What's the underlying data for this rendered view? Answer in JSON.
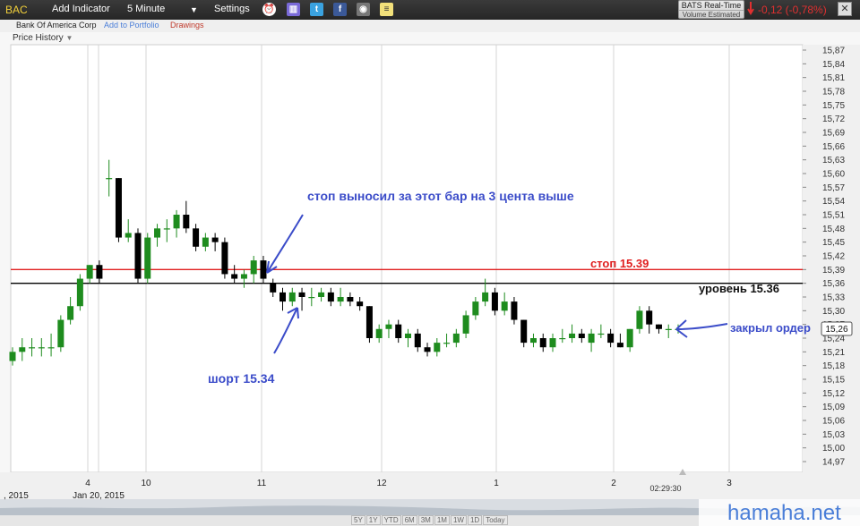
{
  "toolbar": {
    "ticker": "BAC",
    "add_indicator": "Add Indicator",
    "interval": "5 Minute",
    "settings": "Settings",
    "bats_title": "BATS Real-Time",
    "bats_sub": "Volume Estimated",
    "change": "-0,12 (-0,78%)"
  },
  "subbar": {
    "company": "Bank Of America Corp",
    "add_portfolio": "Add to Portfolio",
    "drawings": "Drawings"
  },
  "chart_title": "Price History",
  "range_buttons": [
    "5Y",
    "1Y",
    "YTD",
    "6M",
    "3M",
    "1M",
    "1W",
    "1D",
    "Today"
  ],
  "watermark": "hamaha.net",
  "colors": {
    "up": "#1e8c1e",
    "down": "#000000",
    "stop_line": "#e02020",
    "level_line": "#000000",
    "annotation": "#3b4cc9"
  },
  "chart_data": {
    "type": "candlestick",
    "yaxis_ticks": [
      "15,87",
      "15,84",
      "15,81",
      "15,78",
      "15,75",
      "15,72",
      "15,69",
      "15,66",
      "15,63",
      "15,60",
      "15,57",
      "15,54",
      "15,51",
      "15,48",
      "15,45",
      "15,42",
      "15,39",
      "15,36",
      "15,33",
      "15,30",
      "15,27",
      "15,24",
      "15,21",
      "15,18",
      "15,15",
      "15,12",
      "15,09",
      "15,06",
      "15,03",
      "15,00",
      "14,97"
    ],
    "ylim": [
      14.95,
      15.89
    ],
    "xaxis_labels": [
      ", 2015",
      "Jan 20, 2015",
      "4",
      "10",
      "11",
      "12",
      "1",
      "2",
      "3"
    ],
    "time_label": "02:29:30",
    "last_price": "15,26",
    "levels": [
      {
        "name": "stop",
        "value": 15.39,
        "label": "стоп 15.39"
      },
      {
        "name": "level",
        "value": 15.36,
        "label": "уровень 15.36"
      }
    ],
    "annotations": [
      {
        "name": "stop-note",
        "text": "стоп выносил за этот бар на 3 цента выше"
      },
      {
        "name": "short-note",
        "text": "шорт 15.34"
      },
      {
        "name": "close-note",
        "text": "закрыл ордер"
      }
    ],
    "candles": [
      {
        "o": 15.19,
        "h": 15.22,
        "l": 15.18,
        "c": 15.21
      },
      {
        "o": 15.21,
        "h": 15.24,
        "l": 15.19,
        "c": 15.22
      },
      {
        "o": 15.22,
        "h": 15.24,
        "l": 15.2,
        "c": 15.22
      },
      {
        "o": 15.22,
        "h": 15.24,
        "l": 15.2,
        "c": 15.22
      },
      {
        "o": 15.22,
        "h": 15.25,
        "l": 15.2,
        "c": 15.22
      },
      {
        "o": 15.22,
        "h": 15.29,
        "l": 15.21,
        "c": 15.28
      },
      {
        "o": 15.28,
        "h": 15.33,
        "l": 15.27,
        "c": 15.31
      },
      {
        "o": 15.31,
        "h": 15.38,
        "l": 15.3,
        "c": 15.37
      },
      {
        "o": 15.37,
        "h": 15.4,
        "l": 15.36,
        "c": 15.4
      },
      {
        "o": 15.4,
        "h": 15.41,
        "l": 15.36,
        "c": 15.37
      },
      {
        "o": 15.59,
        "h": 15.63,
        "l": 15.55,
        "c": 15.59
      },
      {
        "o": 15.59,
        "h": 15.59,
        "l": 15.45,
        "c": 15.46
      },
      {
        "o": 15.46,
        "h": 15.5,
        "l": 15.45,
        "c": 15.47
      },
      {
        "o": 15.47,
        "h": 15.48,
        "l": 15.36,
        "c": 15.37
      },
      {
        "o": 15.37,
        "h": 15.47,
        "l": 15.36,
        "c": 15.46
      },
      {
        "o": 15.46,
        "h": 15.49,
        "l": 15.44,
        "c": 15.48
      },
      {
        "o": 15.48,
        "h": 15.5,
        "l": 15.45,
        "c": 15.48
      },
      {
        "o": 15.48,
        "h": 15.52,
        "l": 15.46,
        "c": 15.51
      },
      {
        "o": 15.51,
        "h": 15.54,
        "l": 15.47,
        "c": 15.48
      },
      {
        "o": 15.48,
        "h": 15.49,
        "l": 15.43,
        "c": 15.44
      },
      {
        "o": 15.44,
        "h": 15.47,
        "l": 15.43,
        "c": 15.46
      },
      {
        "o": 15.46,
        "h": 15.47,
        "l": 15.43,
        "c": 15.45
      },
      {
        "o": 15.45,
        "h": 15.46,
        "l": 15.37,
        "c": 15.38
      },
      {
        "o": 15.38,
        "h": 15.4,
        "l": 15.36,
        "c": 15.37
      },
      {
        "o": 15.37,
        "h": 15.39,
        "l": 15.35,
        "c": 15.38
      },
      {
        "o": 15.38,
        "h": 15.42,
        "l": 15.36,
        "c": 15.41
      },
      {
        "o": 15.41,
        "h": 15.42,
        "l": 15.36,
        "c": 15.37
      },
      {
        "o": 15.36,
        "h": 15.37,
        "l": 15.33,
        "c": 15.34
      },
      {
        "o": 15.34,
        "h": 15.35,
        "l": 15.3,
        "c": 15.32
      },
      {
        "o": 15.32,
        "h": 15.35,
        "l": 15.31,
        "c": 15.34
      },
      {
        "o": 15.34,
        "h": 15.35,
        "l": 15.3,
        "c": 15.33
      },
      {
        "o": 15.33,
        "h": 15.35,
        "l": 15.31,
        "c": 15.33
      },
      {
        "o": 15.33,
        "h": 15.35,
        "l": 15.32,
        "c": 15.34
      },
      {
        "o": 15.34,
        "h": 15.35,
        "l": 15.31,
        "c": 15.32
      },
      {
        "o": 15.32,
        "h": 15.35,
        "l": 15.31,
        "c": 15.33
      },
      {
        "o": 15.33,
        "h": 15.34,
        "l": 15.31,
        "c": 15.32
      },
      {
        "o": 15.32,
        "h": 15.33,
        "l": 15.3,
        "c": 15.31
      },
      {
        "o": 15.31,
        "h": 15.31,
        "l": 15.23,
        "c": 15.24
      },
      {
        "o": 15.24,
        "h": 15.27,
        "l": 15.23,
        "c": 15.26
      },
      {
        "o": 15.26,
        "h": 15.28,
        "l": 15.24,
        "c": 15.27
      },
      {
        "o": 15.27,
        "h": 15.28,
        "l": 15.23,
        "c": 15.24
      },
      {
        "o": 15.24,
        "h": 15.26,
        "l": 15.22,
        "c": 15.25
      },
      {
        "o": 15.25,
        "h": 15.26,
        "l": 15.21,
        "c": 15.22
      },
      {
        "o": 15.22,
        "h": 15.23,
        "l": 15.2,
        "c": 15.21
      },
      {
        "o": 15.21,
        "h": 15.24,
        "l": 15.2,
        "c": 15.23
      },
      {
        "o": 15.23,
        "h": 15.25,
        "l": 15.22,
        "c": 15.23
      },
      {
        "o": 15.23,
        "h": 15.26,
        "l": 15.22,
        "c": 15.25
      },
      {
        "o": 15.25,
        "h": 15.3,
        "l": 15.24,
        "c": 15.29
      },
      {
        "o": 15.29,
        "h": 15.33,
        "l": 15.28,
        "c": 15.32
      },
      {
        "o": 15.32,
        "h": 15.37,
        "l": 15.31,
        "c": 15.34
      },
      {
        "o": 15.34,
        "h": 15.35,
        "l": 15.29,
        "c": 15.3
      },
      {
        "o": 15.3,
        "h": 15.34,
        "l": 15.29,
        "c": 15.32
      },
      {
        "o": 15.32,
        "h": 15.33,
        "l": 15.27,
        "c": 15.28
      },
      {
        "o": 15.28,
        "h": 15.28,
        "l": 15.22,
        "c": 15.23
      },
      {
        "o": 15.23,
        "h": 15.25,
        "l": 15.22,
        "c": 15.24
      },
      {
        "o": 15.24,
        "h": 15.25,
        "l": 15.21,
        "c": 15.22
      },
      {
        "o": 15.22,
        "h": 15.25,
        "l": 15.21,
        "c": 15.24
      },
      {
        "o": 15.24,
        "h": 15.26,
        "l": 15.23,
        "c": 15.24
      },
      {
        "o": 15.24,
        "h": 15.27,
        "l": 15.23,
        "c": 15.25
      },
      {
        "o": 15.25,
        "h": 15.26,
        "l": 15.23,
        "c": 15.24
      },
      {
        "o": 15.23,
        "h": 15.26,
        "l": 15.21,
        "c": 15.25
      },
      {
        "o": 15.25,
        "h": 15.27,
        "l": 15.24,
        "c": 15.25
      },
      {
        "o": 15.25,
        "h": 15.26,
        "l": 15.22,
        "c": 15.23
      },
      {
        "o": 15.23,
        "h": 15.25,
        "l": 15.22,
        "c": 15.22
      },
      {
        "o": 15.22,
        "h": 15.26,
        "l": 15.21,
        "c": 15.26
      },
      {
        "o": 15.26,
        "h": 15.31,
        "l": 15.25,
        "c": 15.3
      },
      {
        "o": 15.3,
        "h": 15.31,
        "l": 15.25,
        "c": 15.27
      },
      {
        "o": 15.27,
        "h": 15.27,
        "l": 15.25,
        "c": 15.26
      },
      {
        "o": 15.26,
        "h": 15.27,
        "l": 15.24,
        "c": 15.26
      },
      {
        "o": 15.26,
        "h": 15.27,
        "l": 15.25,
        "c": 15.26
      }
    ]
  }
}
